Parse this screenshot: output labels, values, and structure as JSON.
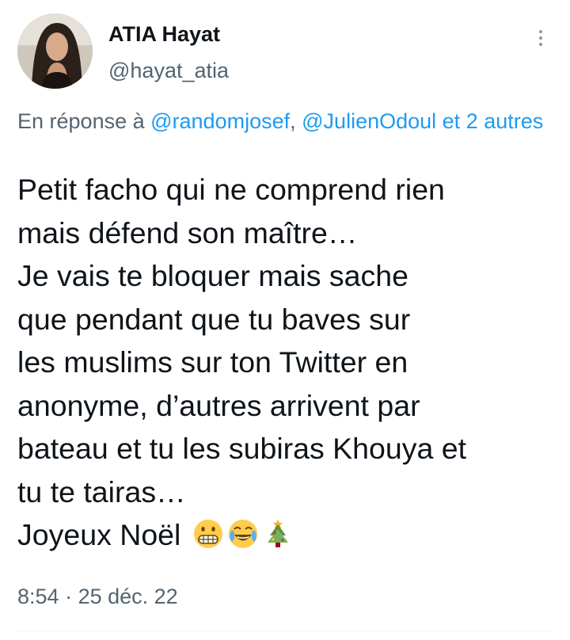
{
  "author": {
    "display_name": "ATIA Hayat",
    "handle": "@hayat_atia"
  },
  "reply_context": {
    "prefix": "En réponse à ",
    "mentions": [
      "@randomjosef",
      "@JulienOdoul"
    ],
    "separator": ", ",
    "suffix_and": " et ",
    "suffix_others": "2 autres"
  },
  "tweet": {
    "lines": [
      "Petit facho qui ne comprend rien",
      "mais défend son maître…",
      "Je vais te bloquer mais sache",
      "que pendant que tu baves sur",
      "les muslims sur ton Twitter en",
      "anonyme, d’autres arrivent par",
      "bateau et tu les subiras Khouya et",
      "tu te tairas…",
      "Joyeux Noël"
    ],
    "emojis": [
      "grimacing-face",
      "face-with-tears-of-joy",
      "christmas-tree"
    ]
  },
  "meta": {
    "time": "8:54",
    "separator": " · ",
    "date": "25 déc. 22"
  },
  "colors": {
    "text": "#0f1419",
    "secondary": "#536471",
    "link": "#1d9bf0"
  }
}
